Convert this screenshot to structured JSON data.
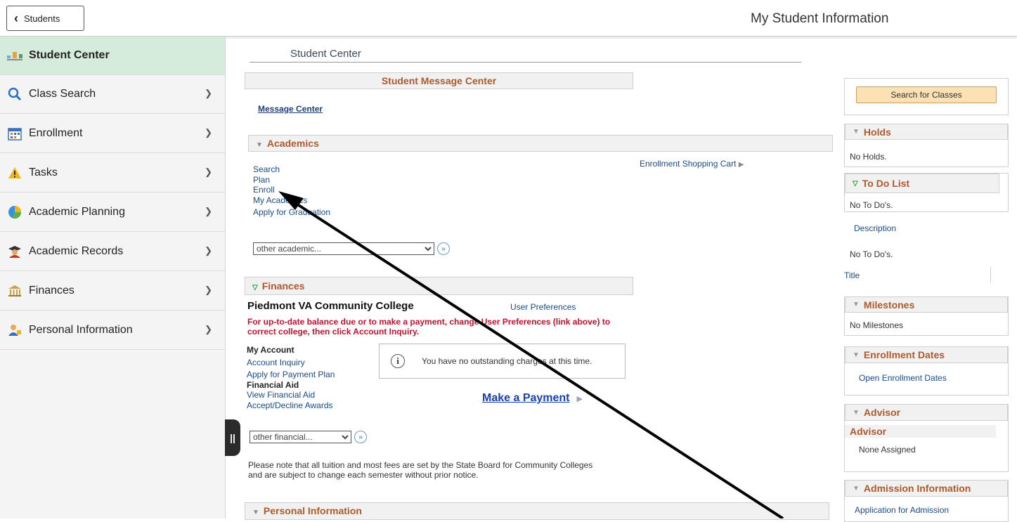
{
  "header": {
    "back_label": "Students",
    "title": "My Student Information"
  },
  "sidebar": {
    "items": [
      {
        "label": "Student Center",
        "icon": "student-center-icon"
      },
      {
        "label": "Class Search",
        "icon": "search-icon"
      },
      {
        "label": "Enrollment",
        "icon": "calendar-icon"
      },
      {
        "label": "Tasks",
        "icon": "warning-icon"
      },
      {
        "label": "Academic Planning",
        "icon": "pie-chart-icon"
      },
      {
        "label": "Academic Records",
        "icon": "graduate-icon"
      },
      {
        "label": "Finances",
        "icon": "bank-icon"
      },
      {
        "label": "Personal Information",
        "icon": "person-icon"
      }
    ]
  },
  "center": {
    "title": "Student Center",
    "message_center": {
      "header": "Student Message Center",
      "link": "Message Center"
    },
    "academics": {
      "header": "Academics",
      "links": [
        "Search",
        "Plan",
        "Enroll",
        "My Academics",
        "Apply for Graduation"
      ],
      "cart_link": "Enrollment Shopping Cart",
      "select_value": "other academic..."
    },
    "finances": {
      "header": "Finances",
      "college": "Piedmont VA Community College",
      "user_pref": "User Preferences",
      "warning": "For up-to-date balance due or to make a payment, change User Preferences (link above) to correct college, then click Account Inquiry.",
      "my_account": "My Account",
      "account_inquiry": "Account Inquiry",
      "payment_plan": "Apply for Payment Plan",
      "financial_aid": "Financial Aid",
      "view_aid": "View Financial Aid",
      "accept_aid": "Accept/Decline Awards",
      "no_charges": "You have no outstanding charges at this time.",
      "make_payment": "Make a Payment",
      "select_value": "other financial...",
      "note": "Please note that all tuition and most fees are set by the State Board for Community Colleges and are subject to change each semester without prior notice."
    },
    "personal": {
      "header": "Personal Information"
    }
  },
  "right": {
    "search_button": "Search for Classes",
    "holds": {
      "header": "Holds",
      "text": "No Holds."
    },
    "todo": {
      "header": "To Do List",
      "text": "No To Do's.",
      "col_description": "Description",
      "text2": "No To Do's.",
      "col_title": "Title"
    },
    "milestones": {
      "header": "Milestones",
      "text": "No Milestones"
    },
    "enrollment_dates": {
      "header": "Enrollment Dates",
      "link": "Open Enrollment Dates"
    },
    "advisor": {
      "header": "Advisor",
      "sub": "Advisor",
      "text": "None Assigned"
    },
    "admission": {
      "header": "Admission Information",
      "link": "Application for Admission"
    }
  }
}
